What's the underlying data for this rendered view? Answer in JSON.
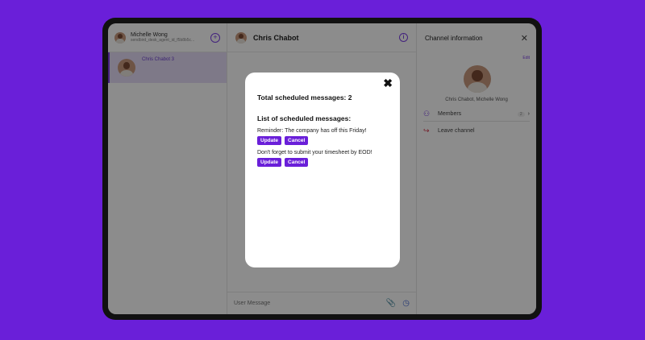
{
  "sidebar": {
    "user_name": "Michelle Wong",
    "user_sub": "sendbird_desk_agent_id_f5b8b5c...",
    "channel_name": "Chris Chabot 3"
  },
  "chat": {
    "title": "Chris Chabot",
    "composer_placeholder": "User Message"
  },
  "info": {
    "title": "Channel information",
    "edit": "Edit",
    "members_label": "Chris Chabot, Michelle Wong",
    "members": "Members",
    "members_count": "2",
    "leave": "Leave channel"
  },
  "modal": {
    "total": "Total scheduled messages: 2",
    "list_title": "List of scheduled messages:",
    "messages": [
      {
        "text": "Reminder: The company has off this Friday!",
        "update": "Update",
        "cancel": "Cancel"
      },
      {
        "text": "Don't forget to submit your timesheet by EOD!",
        "update": "Update",
        "cancel": "Cancel"
      }
    ]
  },
  "colors": {
    "accent": "#6a1fd9",
    "background": "#6a1fd9"
  }
}
